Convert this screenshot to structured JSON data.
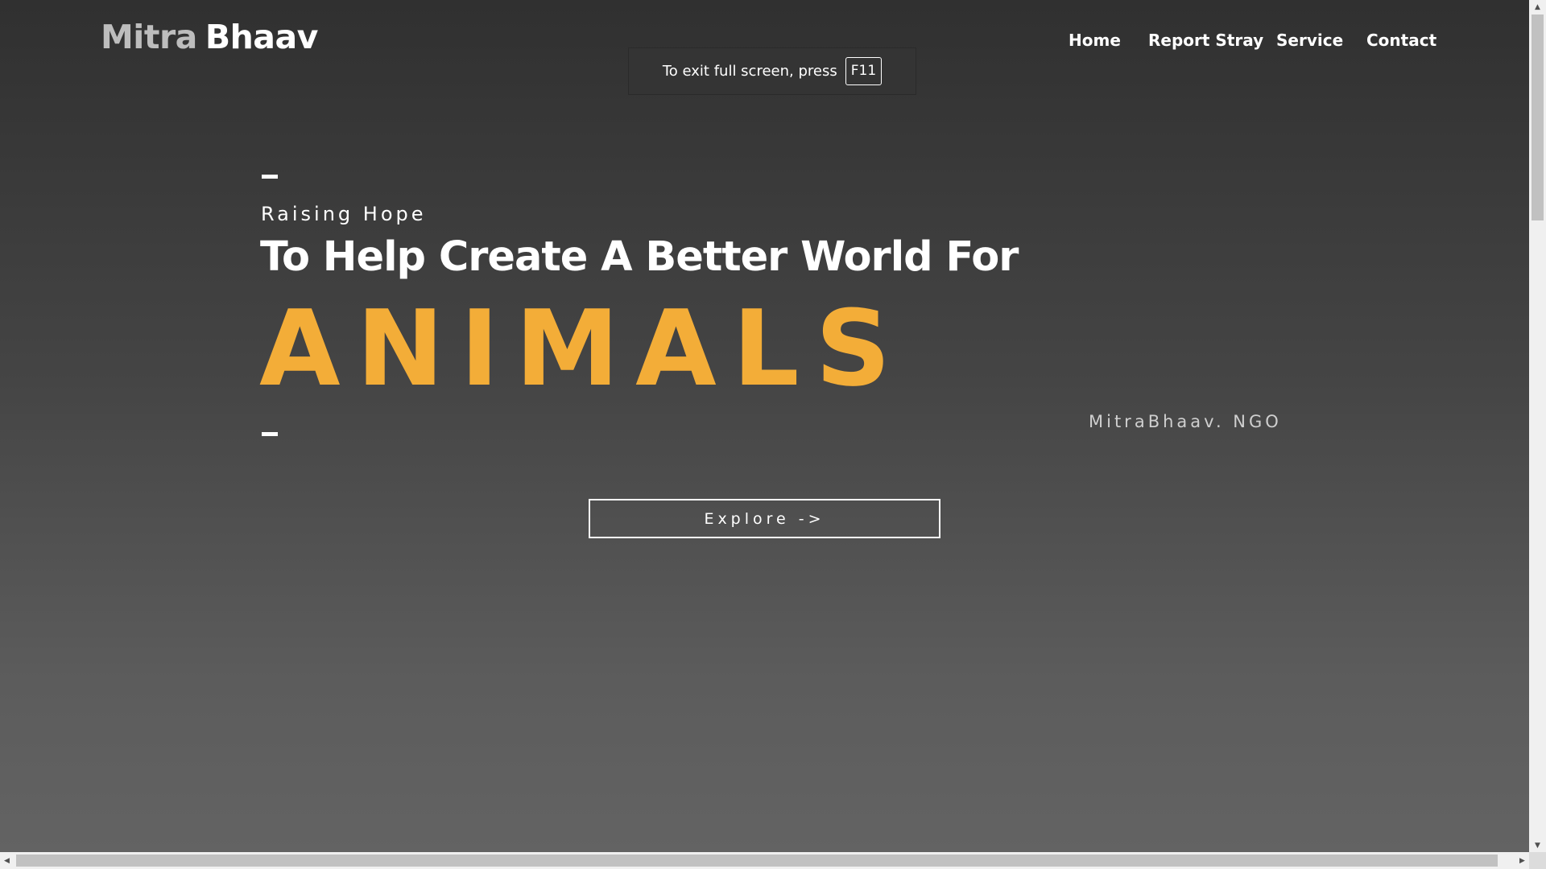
{
  "header": {
    "logo_part1": "Mitra",
    "logo_part2": "Bhaav",
    "nav": [
      {
        "label": "Home"
      },
      {
        "label": "Report Stray"
      },
      {
        "label": "Service"
      },
      {
        "label": "Contact"
      }
    ]
  },
  "toast": {
    "text": "To exit full screen, press",
    "key": "F11"
  },
  "hero": {
    "eyebrow": "Raising Hope",
    "headline": "To Help Create A Better World For",
    "highlight": "ANIMALS",
    "tagline": "MitraBhaav. NGO",
    "cta_label": "Explore ->"
  },
  "colors": {
    "accent": "#f3ad38",
    "text": "#ffffff",
    "logo_muted": "#bdbdbd"
  },
  "icons": {
    "scroll_up": "▲",
    "scroll_down": "▼",
    "scroll_left": "◀",
    "scroll_right": "▶"
  }
}
